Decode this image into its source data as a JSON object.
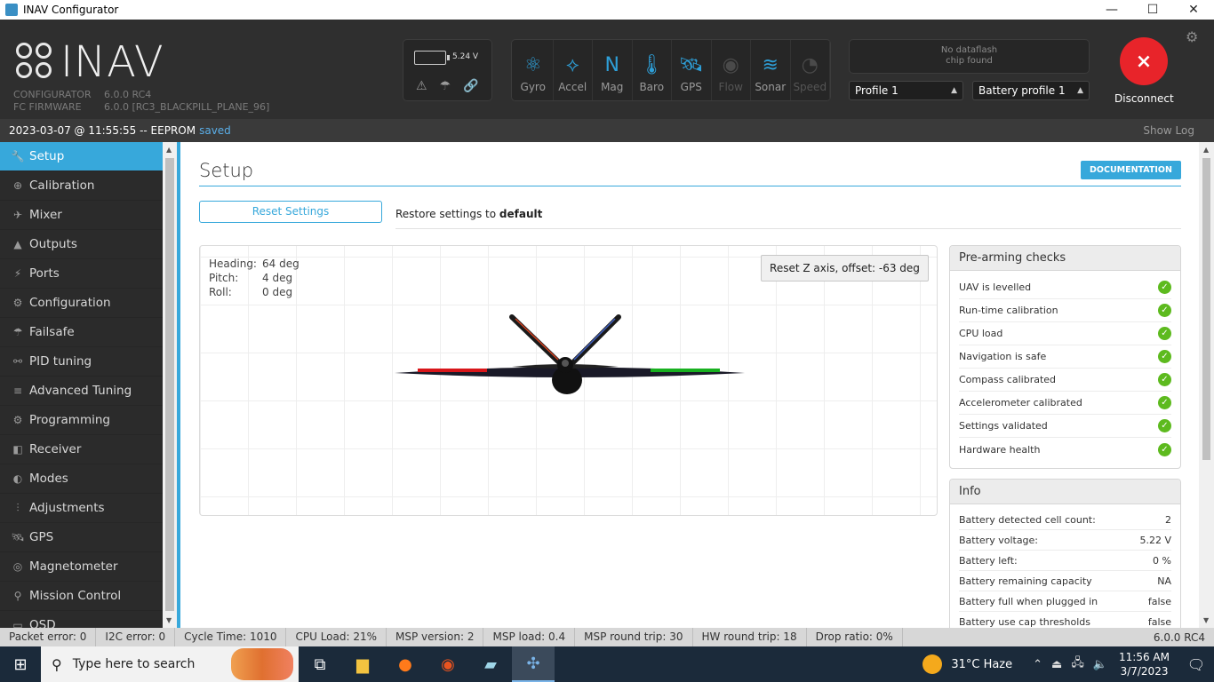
{
  "window": {
    "title": "INAV Configurator",
    "minimize": "—",
    "maximize": "☐",
    "close": "✕"
  },
  "header": {
    "logo_text": "INAV",
    "configurator_label": "CONFIGURATOR",
    "configurator_version": "6.0.0 RC4",
    "firmware_label": "FC FIRMWARE",
    "firmware_version": "6.0.0 [RC3_BLACKPILL_PLANE_96]",
    "battery_voltage": "5.24 V",
    "sensors": [
      {
        "label": "Gyro",
        "icon": "gyro-icon",
        "glyph": "⚛",
        "active": true
      },
      {
        "label": "Accel",
        "icon": "accel-icon",
        "glyph": "⟡",
        "active": true
      },
      {
        "label": "Mag",
        "icon": "mag-icon",
        "glyph": "N",
        "active": true
      },
      {
        "label": "Baro",
        "icon": "baro-icon",
        "glyph": "🌡",
        "active": true
      },
      {
        "label": "GPS",
        "icon": "gps-icon",
        "glyph": "🛰",
        "active": true
      },
      {
        "label": "Flow",
        "icon": "flow-icon",
        "glyph": "◉",
        "active": false
      },
      {
        "label": "Sonar",
        "icon": "sonar-icon",
        "glyph": "≋",
        "active": true
      },
      {
        "label": "Speed",
        "icon": "speed-icon",
        "glyph": "◔",
        "active": false
      }
    ],
    "dataflash_line1": "No dataflash",
    "dataflash_line2": "chip found",
    "profile": "Profile 1",
    "battery_profile": "Battery profile 1",
    "disconnect_label": "Disconnect"
  },
  "logbar": {
    "text": "2023-03-07 @ 11:55:55 -- EEPROM",
    "saved": "saved",
    "show_log": "Show Log"
  },
  "sidebar": {
    "items": [
      {
        "label": "Setup",
        "icon": "wrench-icon",
        "glyph": "🔧"
      },
      {
        "label": "Calibration",
        "icon": "crosshair-icon",
        "glyph": "⊕"
      },
      {
        "label": "Mixer",
        "icon": "mixer-icon",
        "glyph": "✈"
      },
      {
        "label": "Outputs",
        "icon": "outputs-icon",
        "glyph": "▲"
      },
      {
        "label": "Ports",
        "icon": "plug-icon",
        "glyph": "⚡"
      },
      {
        "label": "Configuration",
        "icon": "gear-icon",
        "glyph": "⚙"
      },
      {
        "label": "Failsafe",
        "icon": "parachute-icon",
        "glyph": "☂"
      },
      {
        "label": "PID tuning",
        "icon": "pid-icon",
        "glyph": "⚯"
      },
      {
        "label": "Advanced Tuning",
        "icon": "advanced-tuning-icon",
        "glyph": "≡"
      },
      {
        "label": "Programming",
        "icon": "programming-icon",
        "glyph": "⚙"
      },
      {
        "label": "Receiver",
        "icon": "receiver-icon",
        "glyph": "◧"
      },
      {
        "label": "Modes",
        "icon": "toggle-icon",
        "glyph": "◐"
      },
      {
        "label": "Adjustments",
        "icon": "sliders-icon",
        "glyph": "⫶"
      },
      {
        "label": "GPS",
        "icon": "satellite-icon",
        "glyph": "🛰"
      },
      {
        "label": "Magnetometer",
        "icon": "compass-icon",
        "glyph": "◎"
      },
      {
        "label": "Mission Control",
        "icon": "map-pin-icon",
        "glyph": "⚲"
      },
      {
        "label": "OSD",
        "icon": "osd-icon",
        "glyph": "▭"
      }
    ]
  },
  "main": {
    "title": "Setup",
    "documentation": "DOCUMENTATION",
    "reset_settings": "Reset Settings",
    "restore_text": "Restore settings to",
    "restore_bold": "default",
    "attitude": [
      {
        "label": "Heading:",
        "value": "64 deg"
      },
      {
        "label": "Pitch:",
        "value": "4 deg"
      },
      {
        "label": "Roll:",
        "value": "0 deg"
      }
    ],
    "reset_z": "Reset Z axis, offset: -63 deg",
    "prearming_title": "Pre-arming checks",
    "prearming": [
      "UAV is levelled",
      "Run-time calibration",
      "CPU load",
      "Navigation is safe",
      "Compass calibrated",
      "Accelerometer calibrated",
      "Settings validated",
      "Hardware health"
    ],
    "info_title": "Info",
    "info": [
      {
        "label": "Battery detected cell count:",
        "value": "2"
      },
      {
        "label": "Battery voltage:",
        "value": "5.22 V"
      },
      {
        "label": "Battery left:",
        "value": "0 %"
      },
      {
        "label": "Battery remaining capacity",
        "value": "NA"
      },
      {
        "label": "Battery full when plugged in",
        "value": "false"
      },
      {
        "label": "Battery use cap thresholds",
        "value": "false"
      }
    ]
  },
  "statusbar": {
    "items": [
      "Packet error: 0",
      "I2C error: 0",
      "Cycle Time: 1010",
      "CPU Load: 21%",
      "MSP version: 2",
      "MSP load: 0.4",
      "MSP round trip: 30",
      "HW round trip: 18",
      "Drop ratio: 0%"
    ],
    "version": "6.0.0 RC4"
  },
  "taskbar": {
    "search_placeholder": "Type here to search",
    "weather": "31°C  Haze",
    "time": "11:56 AM",
    "date": "3/7/2023"
  },
  "colors": {
    "accent": "#37a8db",
    "header_bg": "#2f2f2f",
    "sidebar_bg": "#2b2b2b",
    "check_ok": "#5dba1e",
    "disconnect": "#e8242a"
  }
}
